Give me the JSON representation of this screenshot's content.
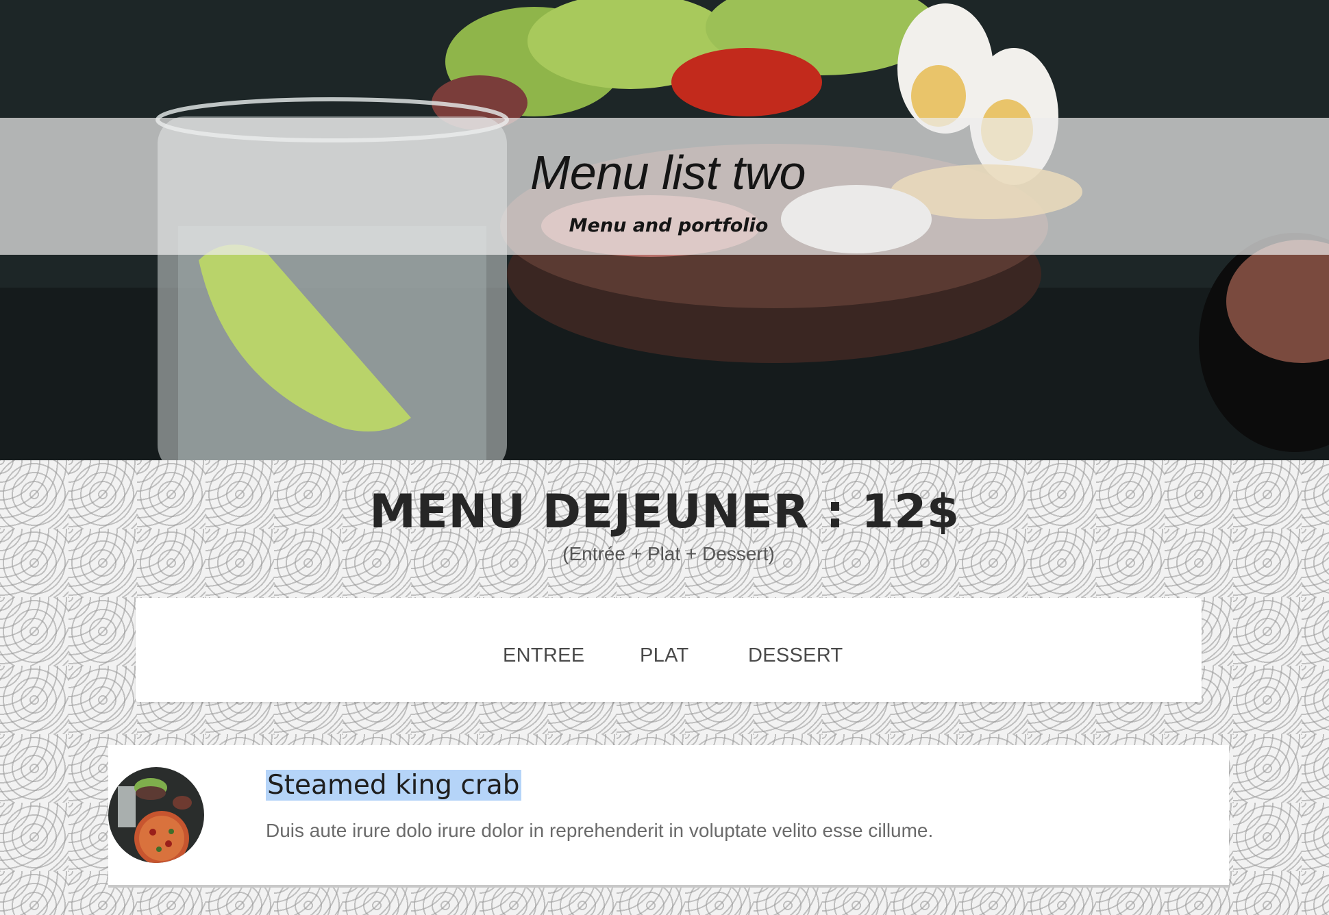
{
  "hero": {
    "title": "Menu list two",
    "subtitle": "Menu and portfolio"
  },
  "menu": {
    "title": "MENU DEJEUNER : 12$",
    "subtitle": "(Entrée + Plat + Dessert)",
    "tabs": [
      {
        "label": "ENTREE"
      },
      {
        "label": "PLAT"
      },
      {
        "label": "DESSERT"
      }
    ],
    "items": [
      {
        "name": "Steamed king crab",
        "description": "Duis aute irure dolo irure dolor in reprehenderit in voluptate velito esse cillume."
      }
    ]
  },
  "colors": {
    "highlight": "#b5d4f8",
    "text_dark": "#262626",
    "text_muted": "#6a6a6a"
  }
}
